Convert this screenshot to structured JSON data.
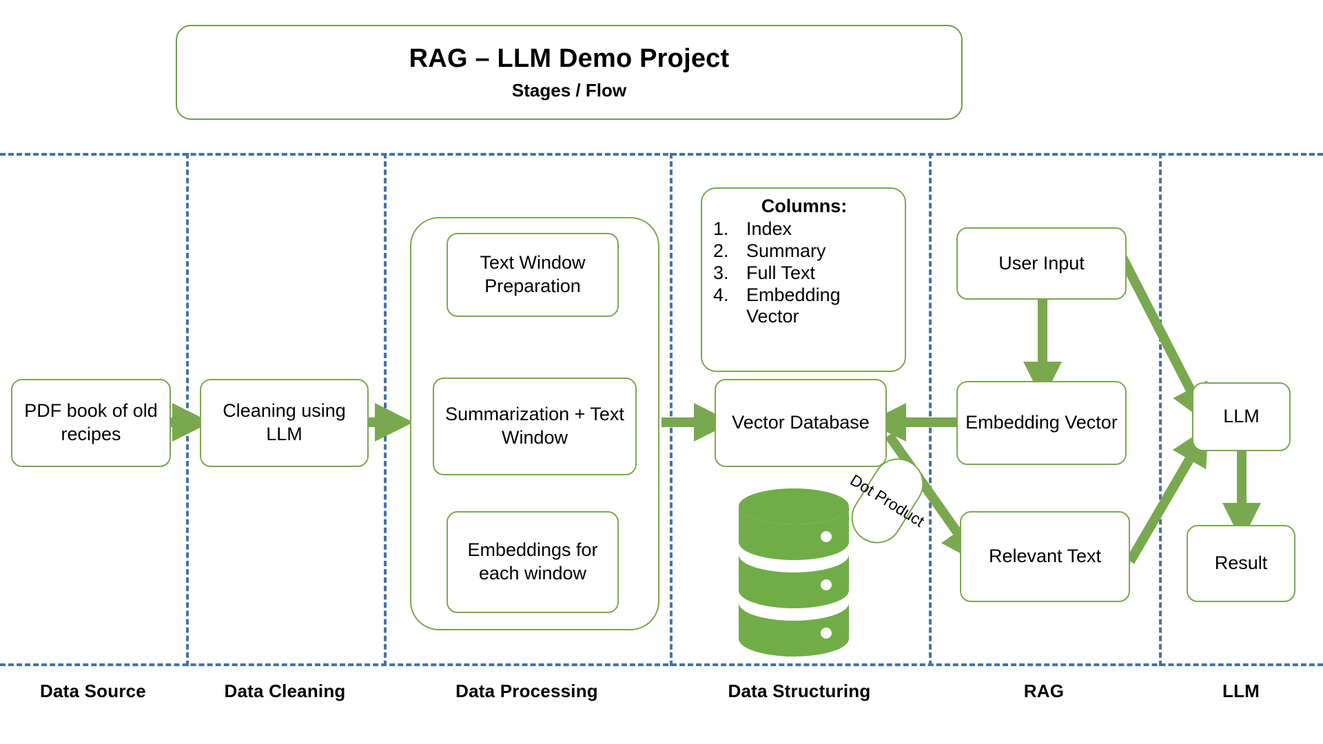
{
  "header": {
    "title": "RAG – LLM Demo Project",
    "subtitle": "Stages / Flow"
  },
  "colors": {
    "accent_green": "#7aa84f",
    "fill_green": "#70ad47",
    "lane_blue": "#4472a8",
    "text": "#000000",
    "background": "#ffffff"
  },
  "stages": [
    {
      "label": "Data Source"
    },
    {
      "label": "Data Cleaning"
    },
    {
      "label": "Data Processing"
    },
    {
      "label": "Data Structuring"
    },
    {
      "label": "RAG"
    },
    {
      "label": "LLM"
    }
  ],
  "nodes": {
    "pdf_source": "PDF book of old recipes",
    "cleaning": "Cleaning using LLM",
    "text_window_prep": "Text Window Preparation",
    "summarization": "Summarization + Text Window",
    "embeddings_window": "Embeddings for each window",
    "vector_database": "Vector Database",
    "user_input": "User Input",
    "embedding_vector": "Embedding Vector",
    "relevant_text": "Relevant Text",
    "llm": "LLM",
    "result": "Result",
    "dot_product": "Dot Product"
  },
  "columns_card": {
    "title": "Columns:",
    "items": [
      {
        "num": "1.",
        "text": "Index"
      },
      {
        "num": "2.",
        "text": "Summary"
      },
      {
        "num": "3.",
        "text": "Full Text"
      },
      {
        "num": "4.",
        "text": "Embedding Vector"
      }
    ]
  },
  "icons": {
    "database": "database-cylinder-icon"
  }
}
